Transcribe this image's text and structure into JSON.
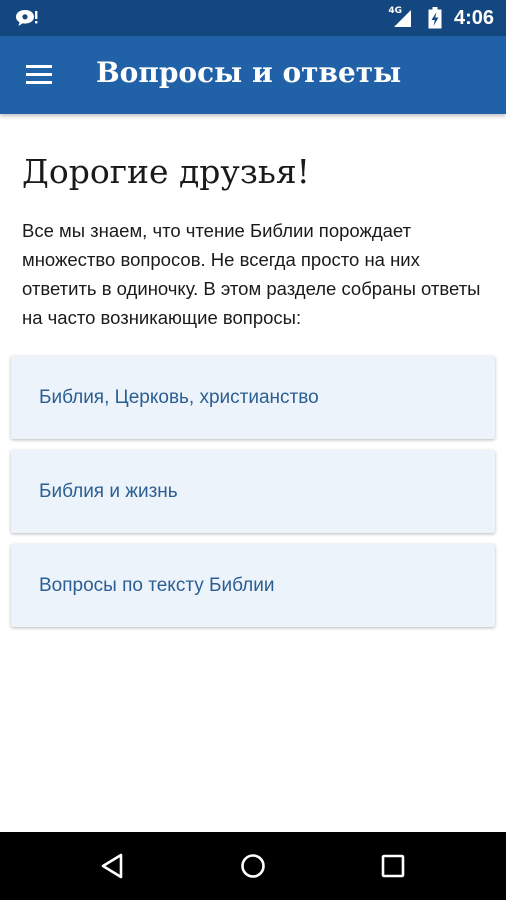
{
  "status_bar": {
    "notification_icon": "chat-bubble-icon",
    "network_label": "4G",
    "signal_icon": "cell-signal-icon",
    "battery_icon": "battery-charging-icon",
    "time": "4:06"
  },
  "app_bar": {
    "menu_icon": "hamburger-menu-icon",
    "title": "Вопросы и ответы",
    "color": "#2161a8",
    "status_color": "#14477f"
  },
  "content": {
    "greeting": "Дорогие друзья!",
    "intro": "Все мы знаем, что чтение Библии порождает множество вопросов. Не всегда просто на них ответить в одиночку. В этом разделе собраны ответы на часто возникающие вопросы:",
    "topics": [
      {
        "label": "Библия, Церковь, христианство"
      },
      {
        "label": "Библия и жизнь"
      },
      {
        "label": "Вопросы по тексту Библии"
      }
    ],
    "card_background": "#edf3fa",
    "card_text_color": "#2b5f94"
  },
  "nav_bar": {
    "back_icon": "back-triangle-icon",
    "home_icon": "home-circle-icon",
    "recents_icon": "recents-square-icon"
  }
}
